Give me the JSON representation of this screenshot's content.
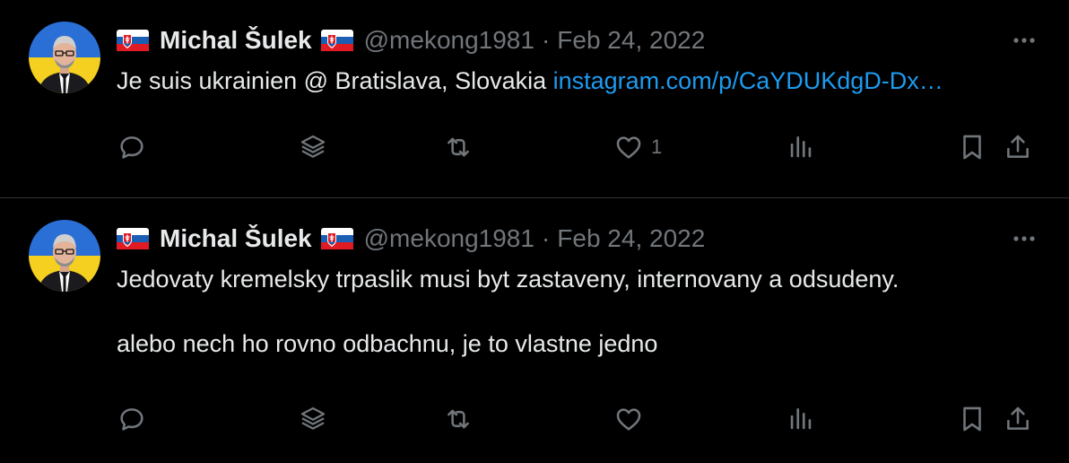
{
  "tweets": [
    {
      "author": {
        "name": "Michal Šulek",
        "handle": "@mekong1981",
        "flag_before": "slovakia-flag",
        "flag_after": "slovakia-flag"
      },
      "separator": "·",
      "date": "Feb 24, 2022",
      "text": "Je suis ukrainien @ Bratislava, Slovakia ",
      "link": "instagram.com/p/CaYDUKdgD-Dx…",
      "actions": {
        "reply": {
          "icon": "reply-icon",
          "count": ""
        },
        "grok": {
          "icon": "layers-icon",
          "count": ""
        },
        "retweet": {
          "icon": "retweet-icon",
          "count": ""
        },
        "like": {
          "icon": "heart-icon",
          "count": "1"
        },
        "views": {
          "icon": "views-chart-icon",
          "count": ""
        },
        "bookmark": {
          "icon": "bookmark-icon"
        },
        "share": {
          "icon": "share-icon"
        }
      }
    },
    {
      "author": {
        "name": "Michal Šulek",
        "handle": "@mekong1981",
        "flag_before": "slovakia-flag",
        "flag_after": "slovakia-flag"
      },
      "separator": "·",
      "date": "Feb 24, 2022",
      "text_line1": "Jedovaty kremelsky trpaslik musi byt zastaveny, internovany a odsudeny.",
      "text_line2": "alebo nech ho rovno odbachnu, je to vlastne jedno",
      "actions": {
        "reply": {
          "icon": "reply-icon",
          "count": ""
        },
        "grok": {
          "icon": "layers-icon",
          "count": ""
        },
        "retweet": {
          "icon": "retweet-icon",
          "count": ""
        },
        "like": {
          "icon": "heart-icon",
          "count": ""
        },
        "views": {
          "icon": "views-chart-icon",
          "count": ""
        },
        "bookmark": {
          "icon": "bookmark-icon"
        },
        "share": {
          "icon": "share-icon"
        }
      }
    }
  ],
  "colors": {
    "background": "#000000",
    "text": "#e7e9ea",
    "muted": "#71767b",
    "link": "#1d9bf0",
    "divider": "#2f3336"
  }
}
